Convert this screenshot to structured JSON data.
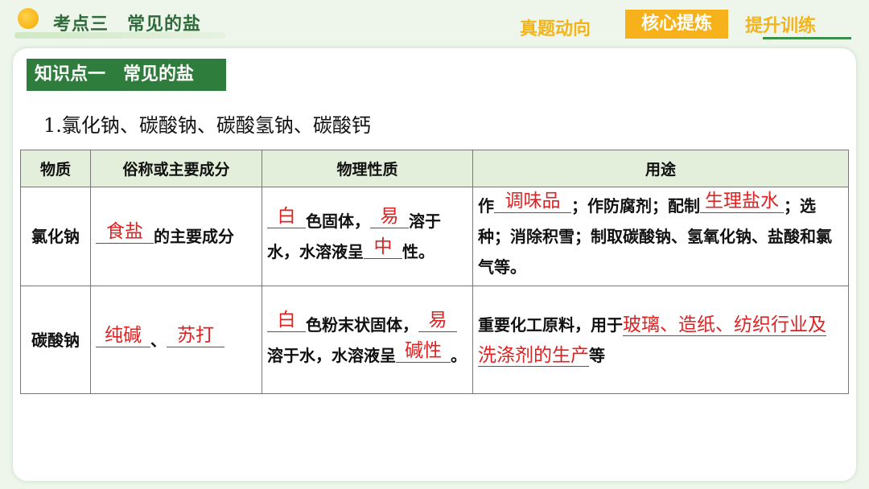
{
  "header": {
    "title": "考点三　常见的盐",
    "tabs": [
      {
        "label": "真题动向"
      },
      {
        "label": "核心提炼"
      },
      {
        "label": "提升训练"
      }
    ]
  },
  "section": {
    "label": "知识点一　常见的盐",
    "subtitle": "1.氯化钠、碳酸钠、碳酸氢钠、碳酸钙"
  },
  "table": {
    "headers": [
      "物质",
      "俗称或主要成分",
      "物理性质",
      "用途"
    ],
    "rows": [
      {
        "name": "氯化钠",
        "alias": {
          "answer": "食盐",
          "text": "的主要成分"
        },
        "physical": {
          "a1": "白",
          "t1": "色固体，",
          "a2": "易",
          "t2": "溶于水，水溶液呈",
          "a3": "中",
          "t3": "性。"
        },
        "use": {
          "t0": "作",
          "a1": "调味品",
          "t1": "；作防腐剂；配制",
          "a2": "生理盐水",
          "t2": "；选种；消除积雪；制取碳酸钠、氢氧化钠、盐酸和氯气等。"
        }
      },
      {
        "name": "碳酸钠",
        "alias": {
          "answer1": "纯碱",
          "sep": "、",
          "answer2": "苏打"
        },
        "physical": {
          "a1": "白",
          "t1": "色粉末状固体，",
          "a2": "易",
          "t2": "溶于水，水溶液呈",
          "a3": "碱性",
          "t3": "。"
        },
        "use": {
          "t0": "重要化工原料，用于",
          "a1": "玻璃、造纸、纺织行业及洗涤剂的生产",
          "t1": "等"
        }
      }
    ]
  },
  "colors": {
    "accent": "#2f7d3c",
    "tab_active": "#f7b21b",
    "tab_inactive": "#f3b41a",
    "answer": "#d22222"
  }
}
